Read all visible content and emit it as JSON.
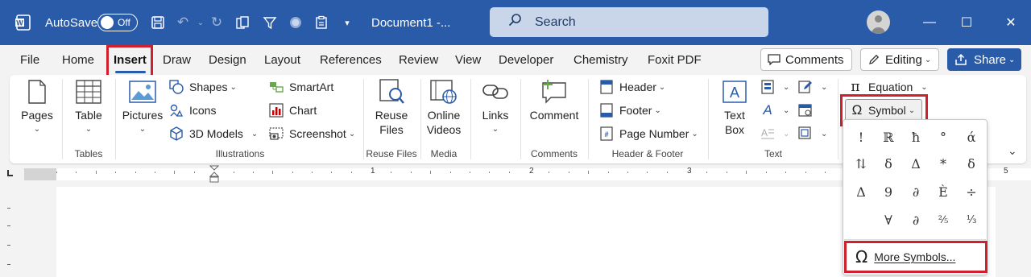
{
  "titlebar": {
    "autosave_label": "AutoSave",
    "autosave_state": "Off",
    "doc_title": "Document1 -...",
    "search_placeholder": "Search",
    "minimize": "—",
    "restore": "☐",
    "close": "✕"
  },
  "menu": {
    "tabs": [
      "File",
      "Home",
      "Insert",
      "Draw",
      "Design",
      "Layout",
      "References",
      "Review",
      "View",
      "Developer",
      "Chemistry",
      "Foxit PDF"
    ],
    "active_tab": "Insert",
    "comments_btn": "Comments",
    "editing_btn": "Editing",
    "share_btn": "Share"
  },
  "ribbon": {
    "pages": "Pages",
    "table": "Table",
    "tables_group": "Tables",
    "pictures": "Pictures",
    "shapes": "Shapes",
    "icons": "Icons",
    "models": "3D Models",
    "smartart": "SmartArt",
    "chart": "Chart",
    "screenshot": "Screenshot",
    "illustrations_group": "Illustrations",
    "reuse_files": [
      "Reuse",
      "Files"
    ],
    "reuse_group": "Reuse Files",
    "online_videos": [
      "Online",
      "Videos"
    ],
    "media_group": "Media",
    "links": "Links",
    "comment": "Comment",
    "comments_group": "Comments",
    "header": "Header",
    "footer": "Footer",
    "page_number": "Page Number",
    "hf_group": "Header & Footer",
    "text_box": [
      "Text",
      "Box"
    ],
    "text_group": "Text",
    "equation": "Equation",
    "symbol": "Symbol"
  },
  "ruler": {
    "numbers": [
      "1",
      "1",
      "2",
      "3",
      "5"
    ]
  },
  "symbol_popup": {
    "symbols": [
      "!",
      "ℝ",
      "ħ",
      "°",
      "ά",
      "⇅",
      "δ",
      "Δ",
      "*",
      "δ",
      "Δ",
      "9",
      "∂",
      "È",
      "÷",
      "",
      "∀",
      "∂",
      "⅖",
      "⅓"
    ],
    "more_symbols": "More Symbols..."
  },
  "colors": {
    "accent": "#2a5ba8",
    "highlight": "#d0202e"
  }
}
